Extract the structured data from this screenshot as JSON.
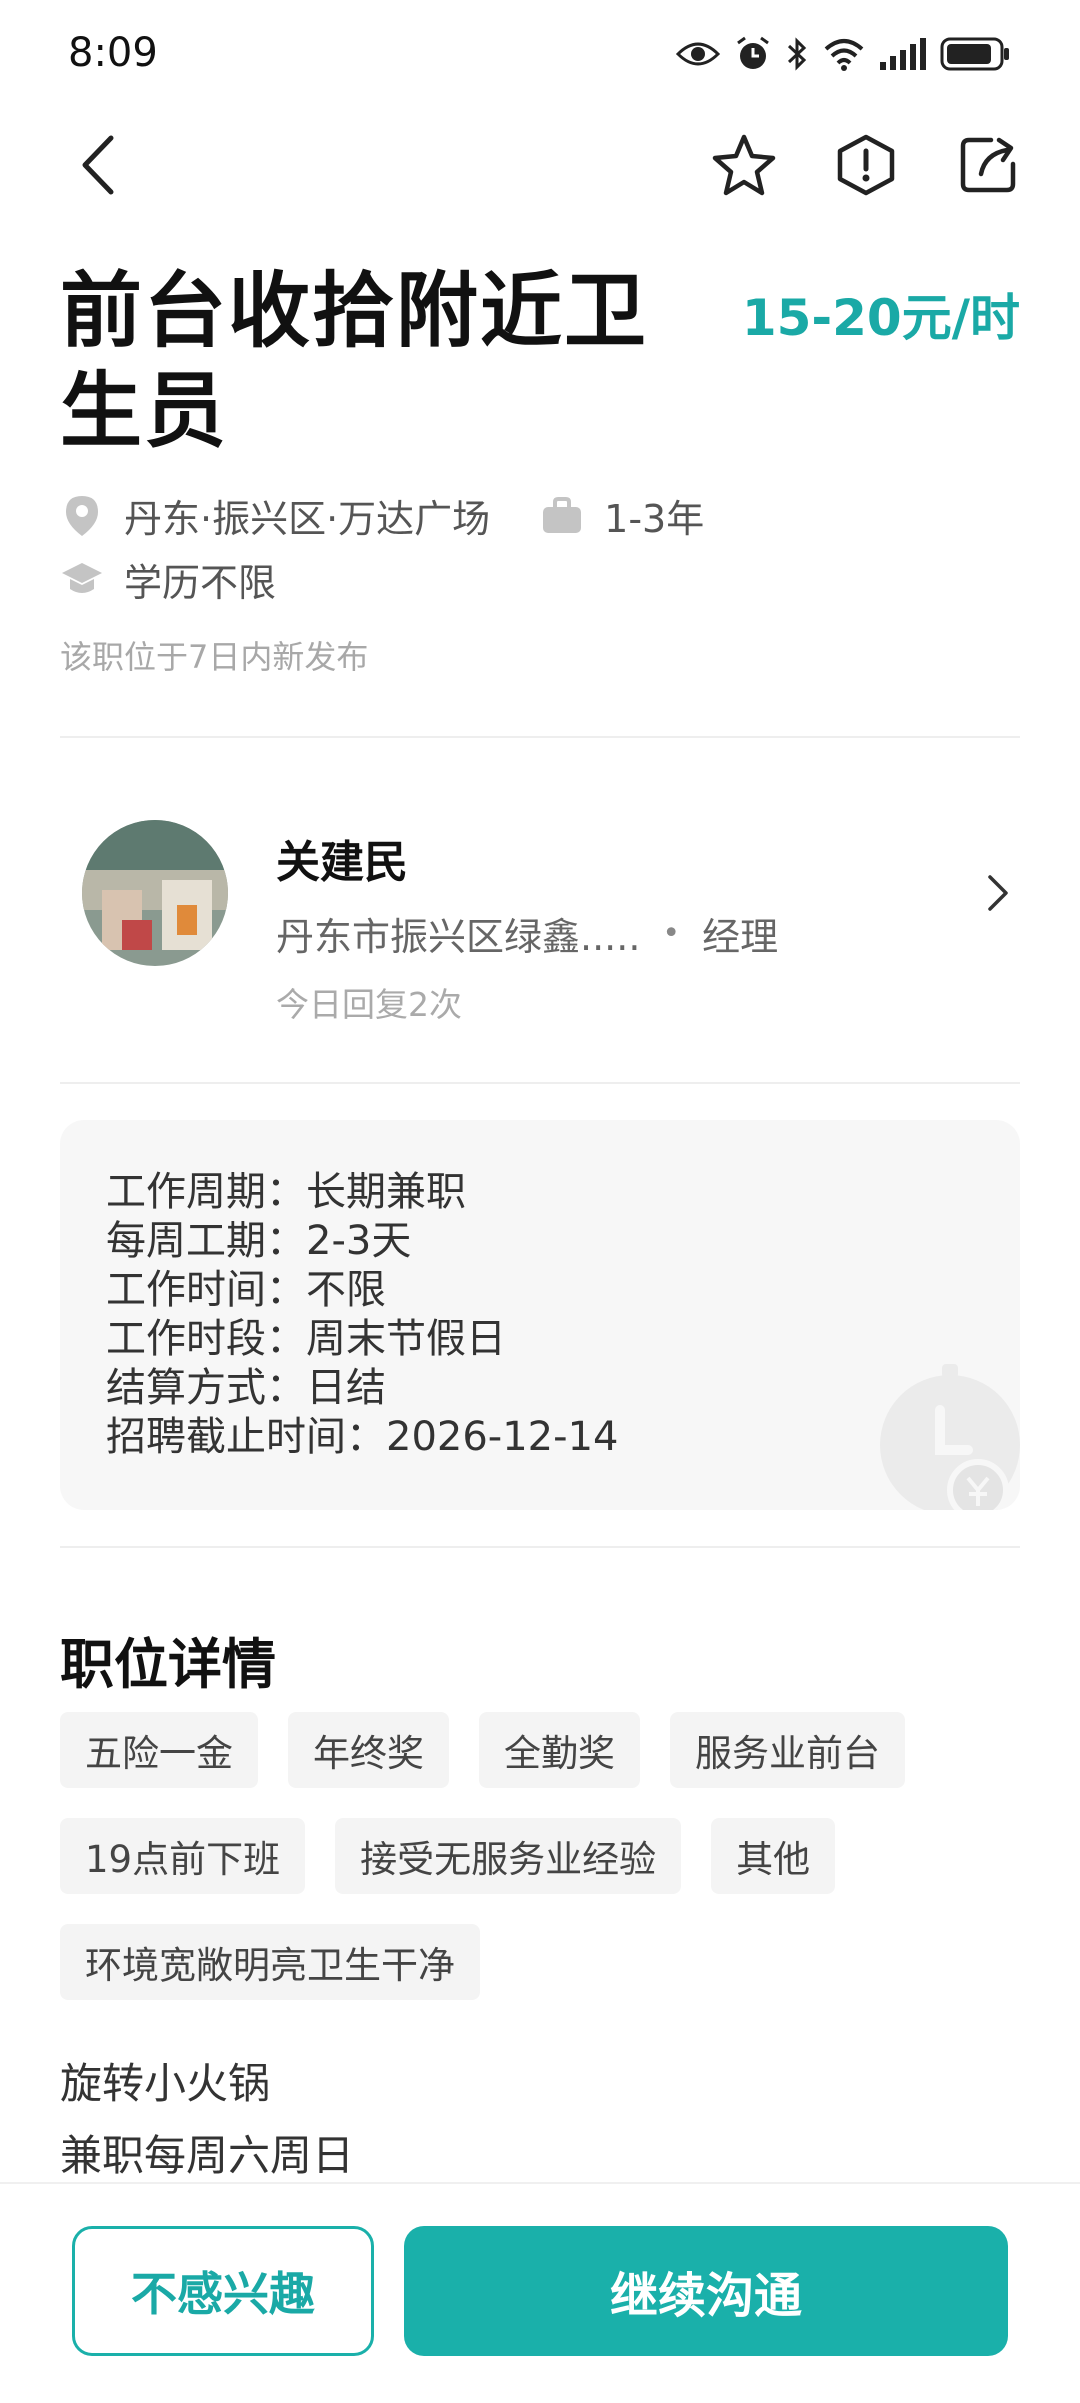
{
  "status_bar": {
    "time": "8:09",
    "icons": [
      "eye-icon",
      "alarm-icon",
      "bluetooth-icon",
      "wifi-icon",
      "signal-icon",
      "battery-icon"
    ]
  },
  "nav": {
    "icons": [
      "back-icon",
      "star-icon",
      "report-icon",
      "share-icon"
    ]
  },
  "job": {
    "title": "前台收拾附近卫生员",
    "salary": "15-20元/时",
    "location": "丹东·振兴区·万达广场",
    "experience": "1-3年",
    "education": "学历不限",
    "posted_note": "该职位于7日内新发布"
  },
  "recruiter": {
    "name": "关建民",
    "company": "丹东市振兴区绿鑫.....",
    "separator": "•",
    "role": "经理",
    "reply_note": "今日回复2次"
  },
  "info_card": {
    "lines": [
      {
        "label": "工作周期：",
        "value": "长期兼职"
      },
      {
        "label": "每周工期：",
        "value": "2-3天"
      },
      {
        "label": "工作时间：",
        "value": "不限"
      },
      {
        "label": "工作时段：",
        "value": "周末节假日"
      },
      {
        "label": "结算方式：",
        "value": "日结"
      },
      {
        "label": "招聘截止时间：",
        "value": "2026-12-14"
      }
    ]
  },
  "details": {
    "title": "职位详情",
    "tags": [
      "五险一金",
      "年终奖",
      "全勤奖",
      "服务业前台",
      "19点前下班",
      "接受无服务业经验",
      "其他",
      "环境宽敞明亮卫生干净"
    ],
    "description": [
      "旋转小火锅",
      "兼职每周六周日"
    ]
  },
  "actions": {
    "not_interested": "不感兴趣",
    "continue_chat": "继续沟通"
  },
  "colors": {
    "accent": "#1ab0aa",
    "salary": "#1aa9a6"
  }
}
